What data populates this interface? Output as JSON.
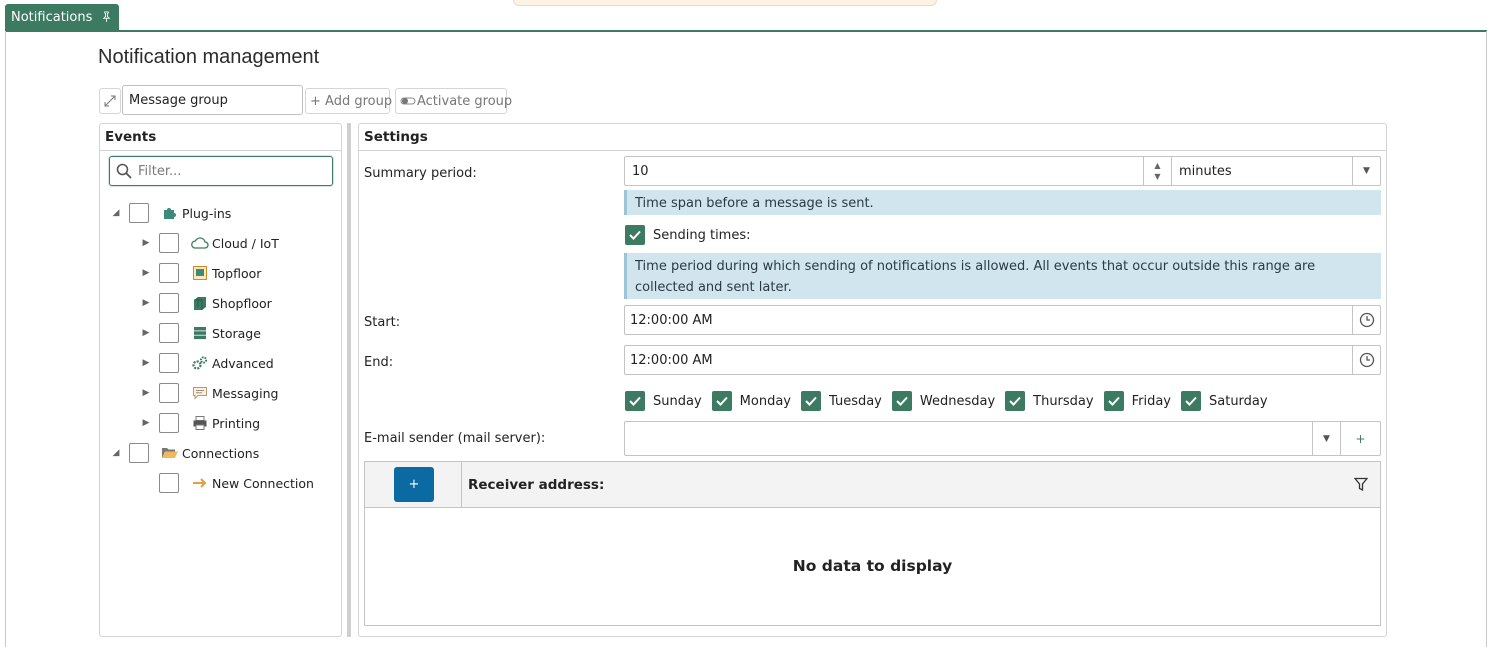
{
  "tab": {
    "label": "Notifications",
    "pin_icon": "pin-icon"
  },
  "page": {
    "title": "Notification management"
  },
  "toolbar": {
    "group_value": "Message group",
    "add_group": "+ Add group",
    "activate_group": "Activate group"
  },
  "events": {
    "title": "Events",
    "filter_placeholder": "Filter...",
    "tree": [
      {
        "label": "Plug-ins",
        "level": 0,
        "expanded": true,
        "icon": "puzzle-icon"
      },
      {
        "label": "Cloud / IoT",
        "level": 1,
        "expanded": false,
        "icon": "cloud-icon"
      },
      {
        "label": "Topfloor",
        "level": 1,
        "expanded": false,
        "icon": "topfloor-icon"
      },
      {
        "label": "Shopfloor",
        "level": 1,
        "expanded": false,
        "icon": "shopfloor-icon"
      },
      {
        "label": "Storage",
        "level": 1,
        "expanded": false,
        "icon": "storage-icon"
      },
      {
        "label": "Advanced",
        "level": 1,
        "expanded": false,
        "icon": "gears-icon"
      },
      {
        "label": "Messaging",
        "level": 1,
        "expanded": false,
        "icon": "message-icon"
      },
      {
        "label": "Printing",
        "level": 1,
        "expanded": false,
        "icon": "printer-icon"
      },
      {
        "label": "Connections",
        "level": 0,
        "expanded": true,
        "icon": "folder-icon"
      },
      {
        "label": "New Connection",
        "level": 1,
        "expanded": null,
        "icon": "arrow-right-icon"
      }
    ]
  },
  "settings": {
    "title": "Settings",
    "summary_period_label": "Summary period:",
    "summary_period_value": "10",
    "summary_period_unit": "minutes",
    "summary_info": "Time span before a message is sent.",
    "sending_times_label": "Sending times:",
    "sending_times_checked": true,
    "sending_info": "Time period during which sending of notifications is allowed. All events that occur outside this range are collected and sent later.",
    "start_label": "Start:",
    "start_value": "12:00:00 AM",
    "end_label": "End:",
    "end_value": "12:00:00 AM",
    "days": [
      {
        "label": "Sunday",
        "checked": true
      },
      {
        "label": "Monday",
        "checked": true
      },
      {
        "label": "Tuesday",
        "checked": true
      },
      {
        "label": "Wednesday",
        "checked": true
      },
      {
        "label": "Thursday",
        "checked": true
      },
      {
        "label": "Friday",
        "checked": true
      },
      {
        "label": "Saturday",
        "checked": true
      }
    ],
    "sender_label": "E-mail sender (mail server):",
    "sender_value": "",
    "add_sender": "+",
    "receiver": {
      "add": "+",
      "column": "Receiver address:",
      "empty": "No data to display"
    }
  },
  "colors": {
    "accent": "#3c7a62",
    "primary_button": "#0b6aa1",
    "info_bg": "#d1e5ee"
  }
}
